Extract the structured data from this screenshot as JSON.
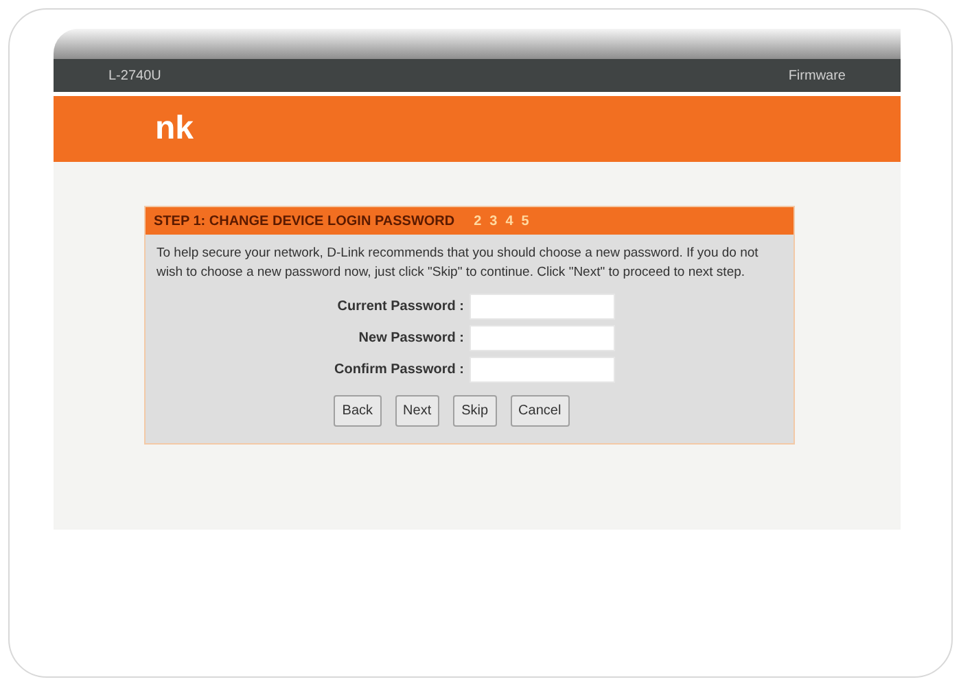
{
  "header": {
    "model": "L-2740U",
    "firmware_label": "Firmware"
  },
  "banner": {
    "logo": "nk"
  },
  "steps": [
    {
      "label": "STEP 1: CHANGE DEVICE LOGIN PASSWORD",
      "selected": true
    },
    {
      "label": "2",
      "selected": false
    },
    {
      "label": "3",
      "selected": false
    },
    {
      "label": "4",
      "selected": false
    },
    {
      "label": "5",
      "selected": false
    }
  ],
  "description": "To help secure your network, D-Link recommends that you should choose a new password. If you do not wish to choose a new password now, just click \"Skip\" to continue. Click \"Next\" to proceed to next step.",
  "fields": [
    {
      "label": "Current Password :"
    },
    {
      "label": "New Password :"
    },
    {
      "label": "Confirm Password :"
    }
  ],
  "buttons": [
    "Back",
    "Next",
    "Skip",
    "Cancel"
  ]
}
